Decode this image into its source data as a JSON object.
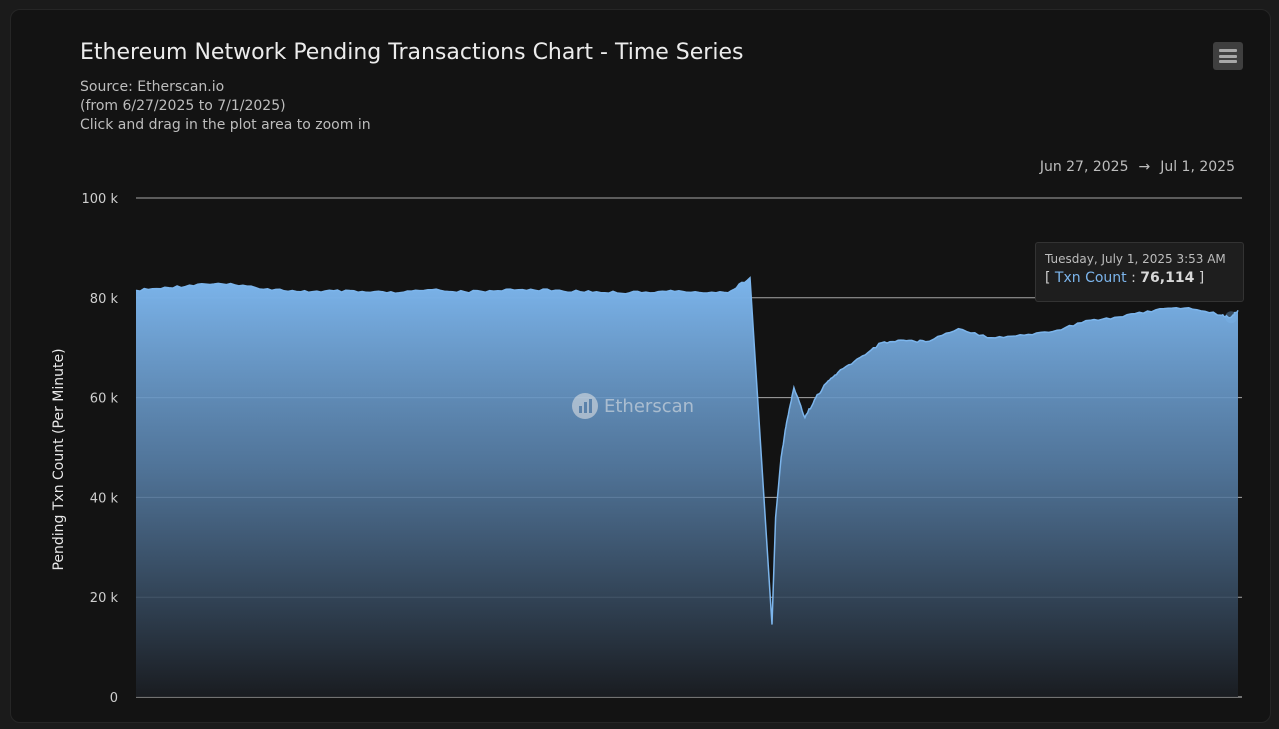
{
  "header": {
    "title": "Ethereum Network Pending Transactions Chart - Time Series",
    "source": "Source: Etherscan.io",
    "period": "(from 6/27/2025 to 7/1/2025)",
    "hint": "Click and drag in the plot area to zoom in"
  },
  "range": {
    "from": "Jun 27, 2025",
    "arrow": "→",
    "to": "Jul 1, 2025"
  },
  "watermark": {
    "text": "Etherscan"
  },
  "tooltip": {
    "date": "Tuesday, July 1, 2025 3:53 AM",
    "open": "[",
    "series": "Txn Count",
    "sep": ":",
    "value": "76,114",
    "close": "]"
  },
  "colors": {
    "series": "#7cb5ec",
    "background": "#131313",
    "grid": "#d8d8d8"
  },
  "chart_data": {
    "type": "area",
    "title": "Ethereum Network Pending Transactions Chart - Time Series",
    "ylabel": "Pending Txn Count (Per Minute)",
    "ylim": [
      0,
      100000
    ],
    "yticks": [
      0,
      20000,
      40000,
      60000,
      80000,
      100000
    ],
    "ytick_labels": [
      "0",
      "20 k",
      "40 k",
      "60 k",
      "80 k",
      "100 k"
    ],
    "grid": true,
    "legend": "none",
    "series": [
      {
        "name": "Txn Count",
        "x": [
          "2025-06-27 00:00",
          "2025-06-27 03:00",
          "2025-06-27 06:00",
          "2025-06-27 09:00",
          "2025-06-27 12:00",
          "2025-06-27 15:00",
          "2025-06-27 18:00",
          "2025-06-27 21:00",
          "2025-06-28 00:00",
          "2025-06-28 03:00",
          "2025-06-28 06:00",
          "2025-06-28 09:00",
          "2025-06-28 12:00",
          "2025-06-28 15:00",
          "2025-06-28 18:00",
          "2025-06-28 21:00",
          "2025-06-29 00:00",
          "2025-06-29 03:00",
          "2025-06-29 06:00",
          "2025-06-29 08:00",
          "2025-06-29 10:00",
          "2025-06-29 10:20",
          "2025-06-29 10:50",
          "2025-06-29 11:20",
          "2025-06-29 12:00",
          "2025-06-29 13:00",
          "2025-06-29 14:00",
          "2025-06-29 15:00",
          "2025-06-29 16:00",
          "2025-06-29 18:00",
          "2025-06-29 20:00",
          "2025-06-29 22:00",
          "2025-06-30 00:00",
          "2025-06-30 03:00",
          "2025-06-30 06:00",
          "2025-06-30 09:00",
          "2025-06-30 12:00",
          "2025-06-30 15:00",
          "2025-06-30 18:00",
          "2025-06-30 21:00",
          "2025-07-01 00:00",
          "2025-07-01 03:00",
          "2025-07-01 03:53",
          "2025-07-01 04:30"
        ],
        "values": [
          81500,
          82000,
          82800,
          82600,
          81800,
          81200,
          81400,
          81100,
          81000,
          81600,
          81200,
          81400,
          81700,
          81300,
          81200,
          81000,
          81300,
          81200,
          81000,
          84000,
          14500,
          36000,
          48000,
          55000,
          62000,
          56000,
          60000,
          63000,
          65000,
          68000,
          71000,
          71500,
          71200,
          73800,
          72000,
          72500,
          73500,
          75500,
          76200,
          77600,
          78000,
          76500,
          76114,
          77500
        ]
      }
    ]
  }
}
